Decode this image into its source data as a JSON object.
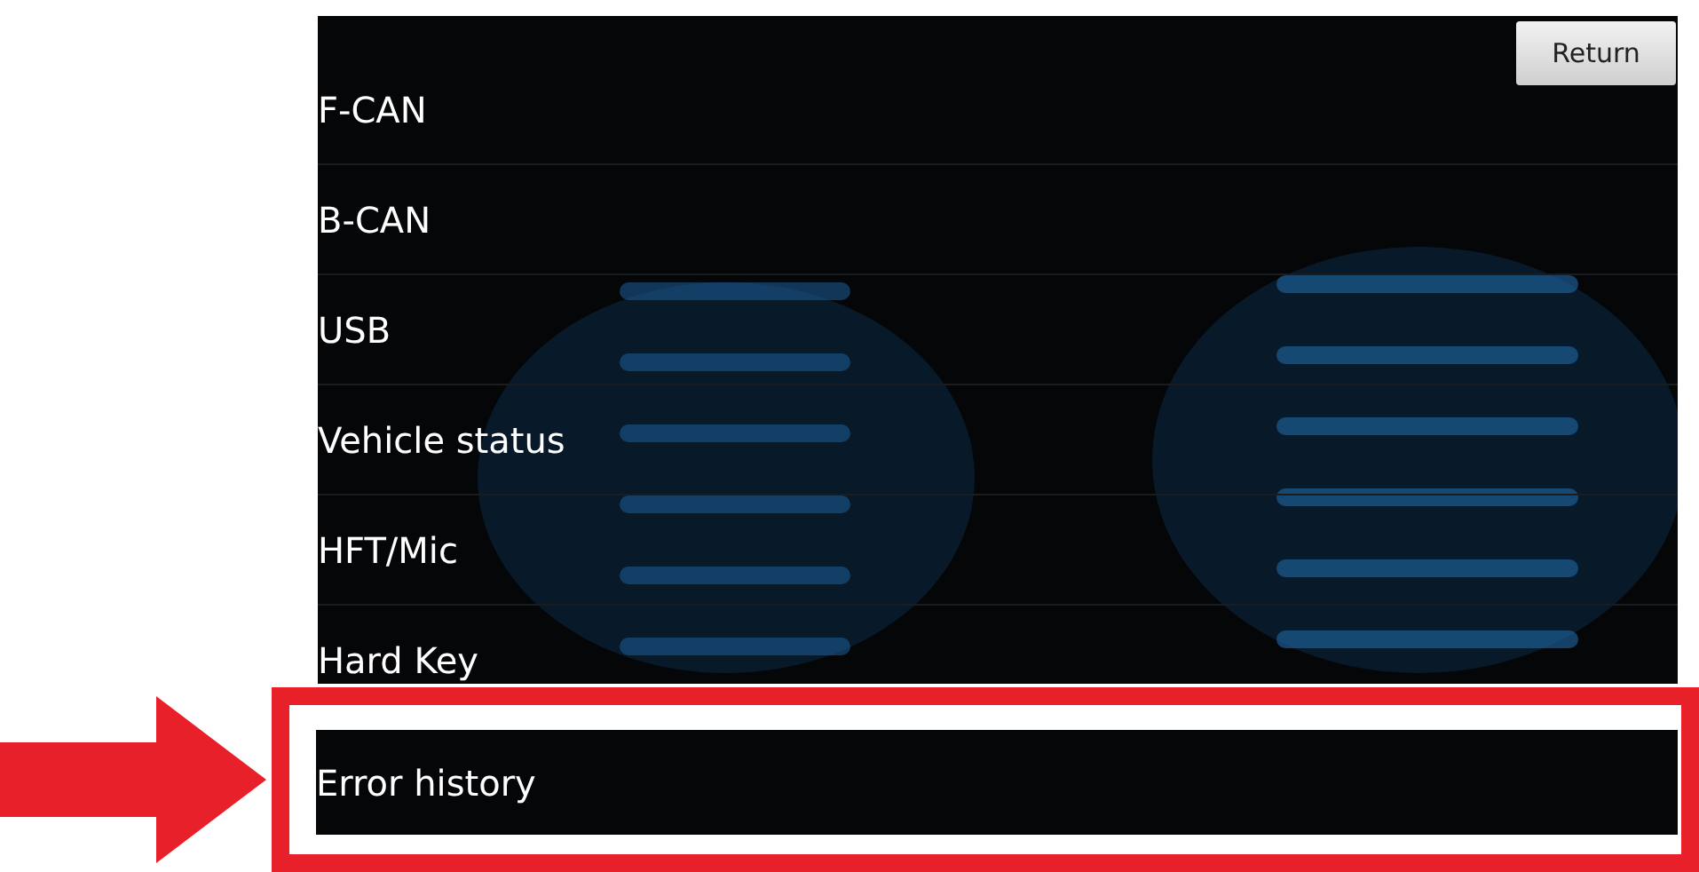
{
  "return_button": {
    "label": "Return"
  },
  "menu_items": [
    {
      "label": "F-CAN",
      "highlighted": false
    },
    {
      "label": "B-CAN",
      "highlighted": false
    },
    {
      "label": "USB",
      "highlighted": false
    },
    {
      "label": "Vehicle status",
      "highlighted": false
    },
    {
      "label": "HFT/Mic",
      "highlighted": false
    },
    {
      "label": "Hard Key",
      "highlighted": false
    },
    {
      "label": "Error history",
      "highlighted": true
    }
  ]
}
